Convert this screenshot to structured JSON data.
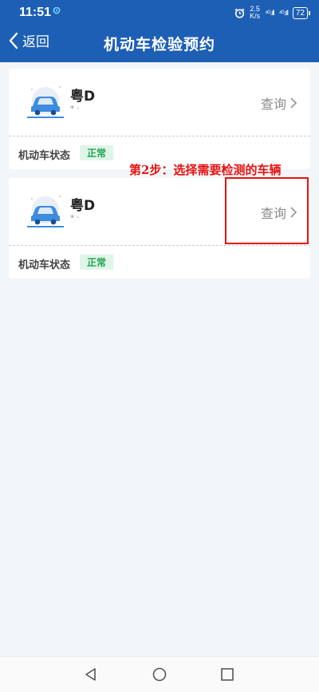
{
  "status_bar": {
    "time": "11:51",
    "net_speed_value": "2.5",
    "net_speed_unit": "K/s",
    "signal_1": "⁴ᴳ.ıll",
    "signal_2": "⁴ᴳ.ıll",
    "battery": "72"
  },
  "nav": {
    "back_label": "返回",
    "title": "机动车检验预约"
  },
  "vehicles": [
    {
      "plate": "粤D",
      "sub": "* ·",
      "query_label": "查询",
      "status_label": "机动车状态",
      "status_value": "正常"
    },
    {
      "plate": "粤D",
      "sub": "* ·",
      "query_label": "查询",
      "status_label": "机动车状态",
      "status_value": "正常"
    }
  ],
  "annotation": {
    "text": "第2步：选择需要检测的车辆"
  },
  "colors": {
    "header": "#1d5fb4",
    "annotation_red": "#e8110f",
    "badge_green": "#21a352",
    "badge_bg": "#dff5e7"
  },
  "icons": {
    "back": "chevron-left-icon",
    "car": "car-icon",
    "query_arrow": "chevron-right-icon",
    "alarm": "alarm-icon",
    "location": "location-icon",
    "nav_back": "triangle-back-icon",
    "nav_home": "circle-home-icon",
    "nav_recent": "square-recent-icon"
  }
}
